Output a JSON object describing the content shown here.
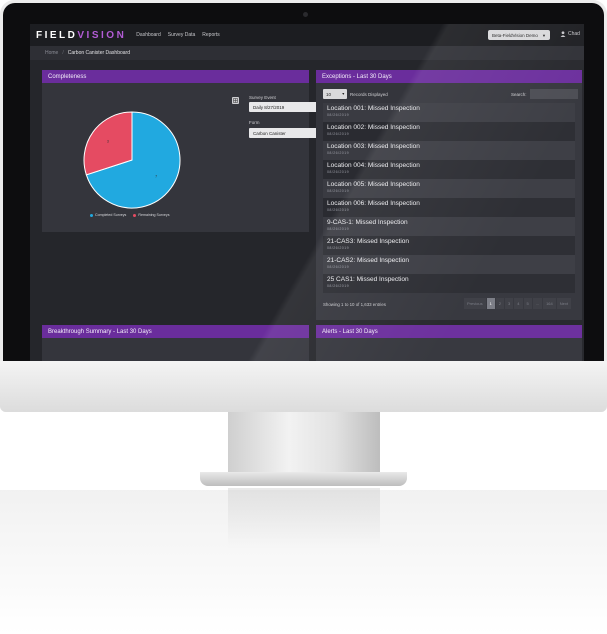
{
  "app": {
    "logo_part1": "FIELD",
    "logo_part2": "VISION",
    "nav": [
      "Dashboard",
      "Survey Data",
      "Reports"
    ],
    "environment": "Beta-FieldVision Demo",
    "user": "Chad"
  },
  "breadcrumb": {
    "home": "Home",
    "separator": "/",
    "current": "Carbon Canister Dashboard"
  },
  "completeness": {
    "title": "Completeness",
    "survey_event_label": "Survey Event",
    "survey_event_value": "Daily 8/27/2019",
    "form_label": "Form",
    "form_value": "Carbon Canister",
    "legend": [
      "Completed Surveys",
      "Remaining Surveys"
    ],
    "slice_labels": [
      "3",
      "7"
    ]
  },
  "chart_data": {
    "type": "pie",
    "categories": [
      "Completed Surveys",
      "Remaining Surveys"
    ],
    "values": [
      7,
      3
    ],
    "colors": [
      "#21a9e0",
      "#e54b62"
    ]
  },
  "exceptions": {
    "title": "Exceptions - Last 30 Days",
    "page_size": "10",
    "records_label": "Records Displayed",
    "search_label": "Search:",
    "rows": [
      {
        "title": "Location 001: Missed Inspection",
        "date": "08/26/2019"
      },
      {
        "title": "Location 002: Missed Inspection",
        "date": "08/26/2019"
      },
      {
        "title": "Location 003: Missed Inspection",
        "date": "08/26/2019"
      },
      {
        "title": "Location 004: Missed Inspection",
        "date": "08/26/2019"
      },
      {
        "title": "Location 005: Missed Inspection",
        "date": "08/26/2019"
      },
      {
        "title": "Location 006: Missed Inspection",
        "date": "08/26/2019"
      },
      {
        "title": "9-CAS-1: Missed Inspection",
        "date": "08/26/2019"
      },
      {
        "title": "21-CAS3: Missed Inspection",
        "date": "08/26/2019"
      },
      {
        "title": "21-CAS2: Missed Inspection",
        "date": "08/26/2019"
      },
      {
        "title": "25 CAS1: Missed Inspection",
        "date": "08/26/2019"
      }
    ],
    "showing": "Showing 1 to 10 of 1,633 entries",
    "pager": [
      "Previous",
      "1",
      "2",
      "3",
      "4",
      "5",
      "...",
      "164",
      "Next"
    ]
  },
  "breakthrough": {
    "title": "Breakthrough Summary - Last 30 Days"
  },
  "alerts": {
    "title": "Alerts - Last 30 Days"
  },
  "icons": {
    "dropdown": "chevron-down-icon",
    "user": "user-icon",
    "export": "grid-icon"
  }
}
